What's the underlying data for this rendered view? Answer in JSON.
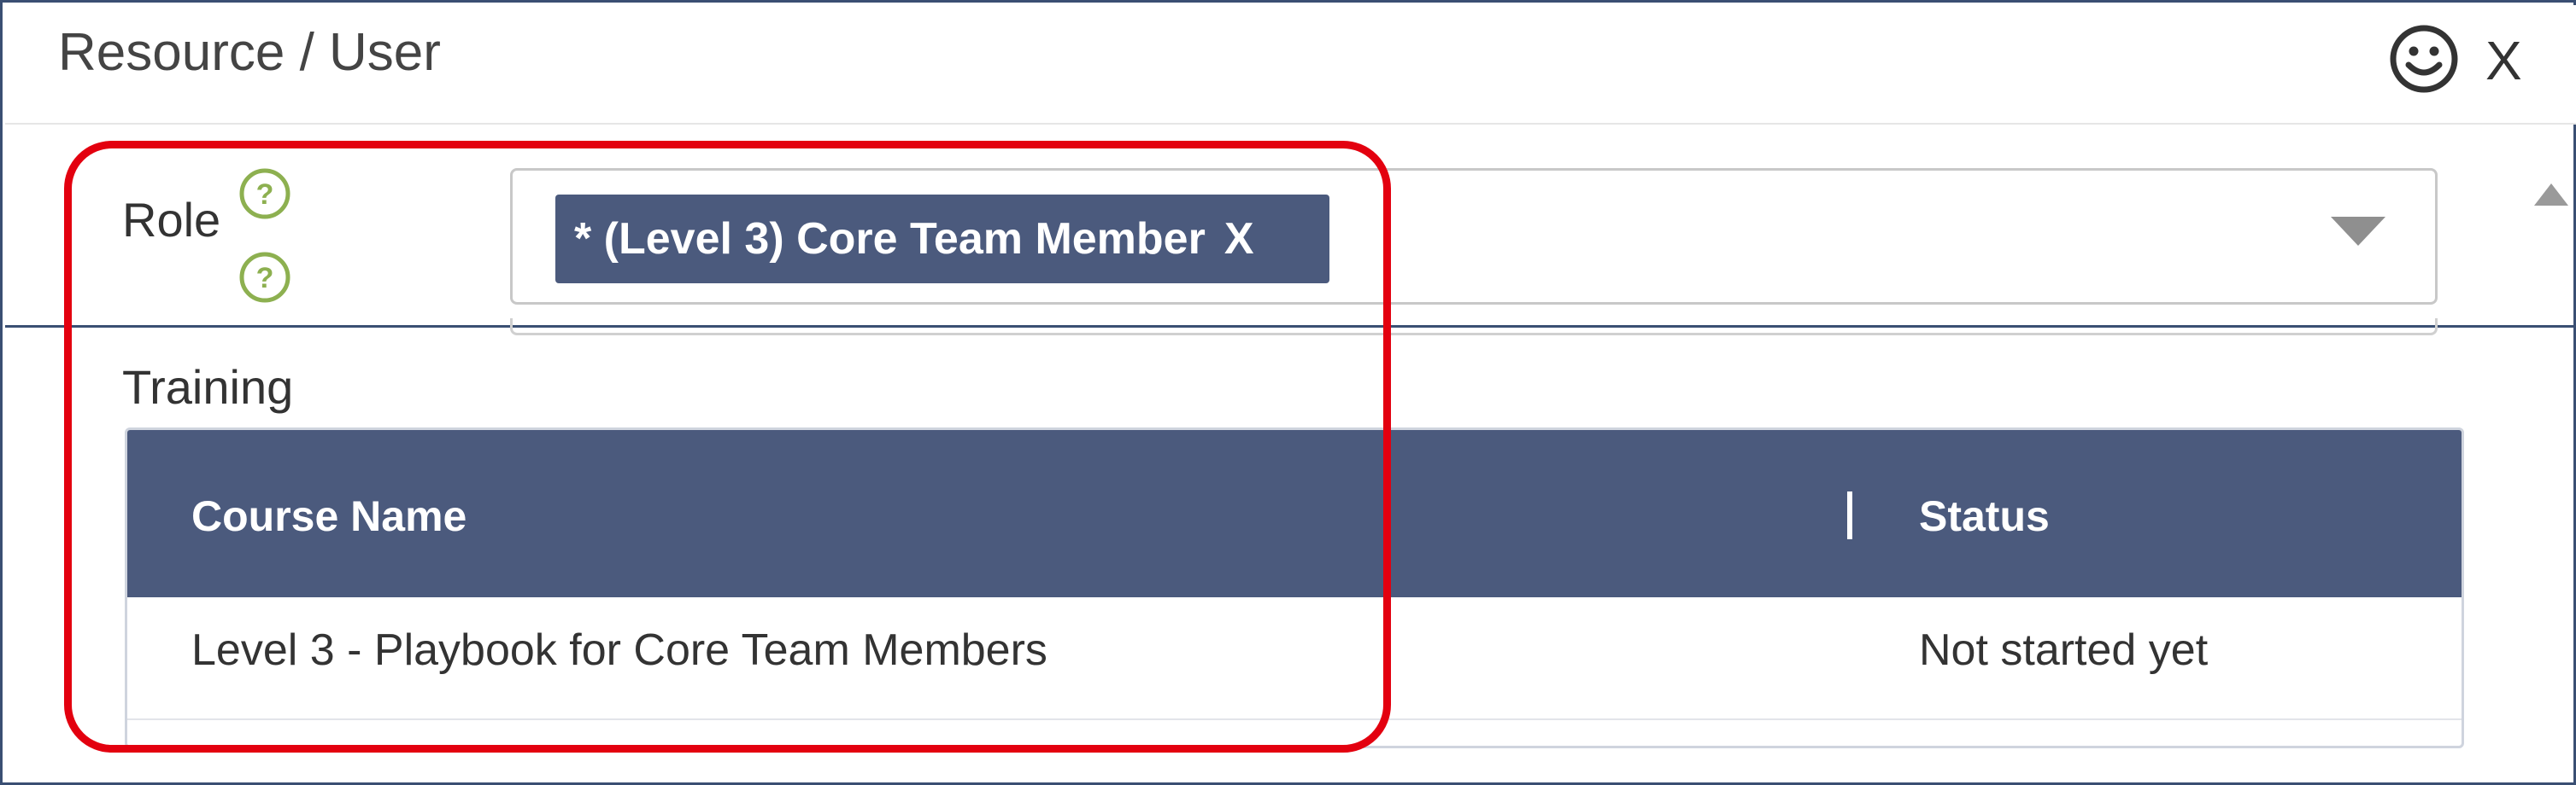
{
  "header": {
    "title": "Resource / User",
    "close_label": "X",
    "feedback_icon": "smiley-face-icon"
  },
  "role": {
    "label": "Role",
    "help_icon": "question-circle-icon",
    "selected_tag": "* (Level 3) Core Team Member",
    "tag_remove_label": "X",
    "dropdown_icon": "caret-down-icon"
  },
  "training": {
    "label": "Training",
    "columns": [
      "Course Name",
      "Status"
    ],
    "rows": [
      {
        "course_name": "Level 3 - Playbook for Core Team Members",
        "status": "Not started yet"
      }
    ]
  },
  "colors": {
    "header_bg": "#4b5a7d",
    "tag_bg": "#4b5a7d",
    "help_icon": "#8db050",
    "highlight": "#e3000f"
  }
}
